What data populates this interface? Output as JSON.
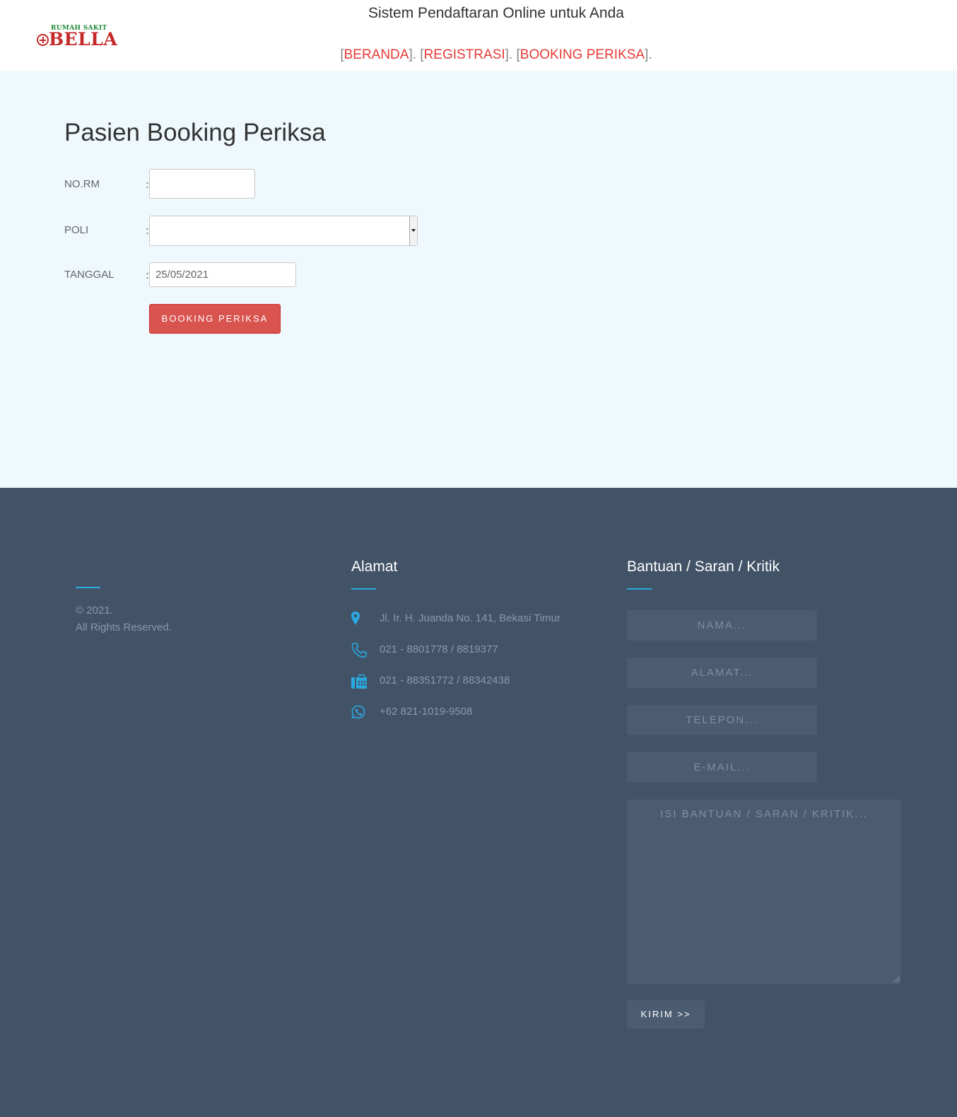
{
  "header": {
    "logo_small": "RUMAH SAKIT",
    "logo_big": "BELLA",
    "site_title": "Sistem Pendaftaran Online untuk Anda",
    "nav": [
      {
        "label": "BERANDA"
      },
      {
        "label": "REGISTRASI"
      },
      {
        "label": "BOOKING PERIKSA"
      }
    ]
  },
  "main": {
    "page_title": "Pasien Booking Periksa",
    "fields": {
      "norm": {
        "label": "NO.RM",
        "value": ""
      },
      "poli": {
        "label": "POLI",
        "value": ""
      },
      "tanggal": {
        "label": "TANGGAL",
        "value": "25/05/2021"
      }
    },
    "submit_label": "BOOKING PERIKSA"
  },
  "footer": {
    "copyright_line1": "© 2021.",
    "copyright_line2": "All Rights Reserved.",
    "address": {
      "title": "Alamat",
      "items": [
        {
          "icon": "map-marker-icon",
          "text": "Jl. Ir. H. Juanda No. 141, Bekasi Timur"
        },
        {
          "icon": "phone-icon",
          "text": "021 - 8801778 / 8819377"
        },
        {
          "icon": "fax-icon",
          "text": "021 - 88351772 / 88342438"
        },
        {
          "icon": "whatsapp-icon",
          "text": "+62 821-1019-9508"
        }
      ]
    },
    "feedback": {
      "title": "Bantuan / Saran / Kritik",
      "name_placeholder": "NAMA...",
      "address_placeholder": "ALAMAT...",
      "phone_placeholder": "TELEPON...",
      "email_placeholder": "E-MAIL...",
      "message_placeholder": "ISI BANTUAN / SARAN / KRITIK...",
      "submit_label": "KIRIM >>"
    }
  },
  "colors": {
    "accent_red": "#e53935",
    "button_red": "#d9534f",
    "main_bg": "#eff8fd",
    "footer_bg": "#425368",
    "footer_accent": "#29a9e0"
  }
}
